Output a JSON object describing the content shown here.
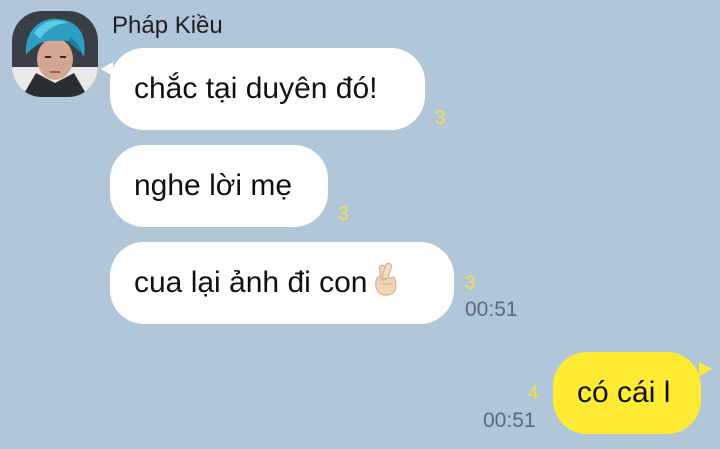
{
  "sender": {
    "name": "Pháp Kiều"
  },
  "messages": [
    {
      "text": "chắc tại duyên đó!",
      "unread": "3"
    },
    {
      "text": "nghe lời mẹ",
      "unread": "3"
    },
    {
      "text": "cua lại ảnh đi con",
      "emoji": "crossed-fingers-icon",
      "unread": "3",
      "time": "00:51"
    }
  ],
  "my_message": {
    "text": "có cái l",
    "unread": "4",
    "time": "00:51"
  },
  "colors": {
    "background": "#b2c6d9",
    "incoming_bubble": "#ffffff",
    "outgoing_bubble": "#ffeb33",
    "unread_count": "#f2e14c",
    "timestamp": "#5c6a76"
  }
}
